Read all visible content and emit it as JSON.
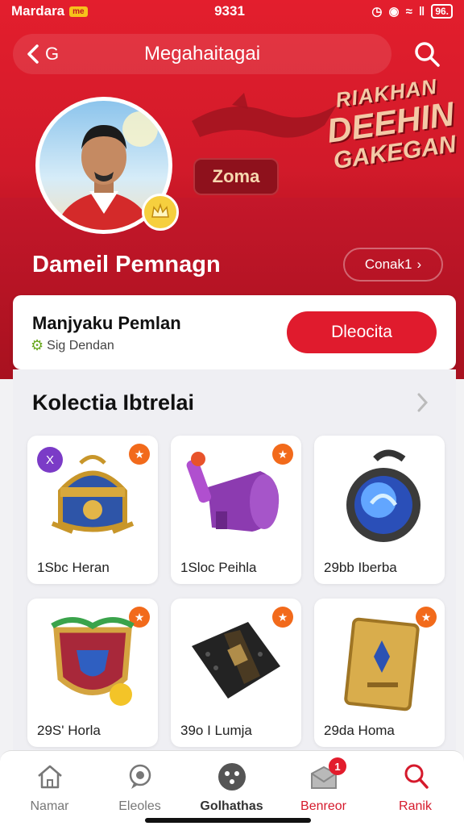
{
  "status_bar": {
    "carrier": "Mardara",
    "carrier_badge": "me",
    "time": "9331",
    "battery": "96."
  },
  "header": {
    "back_label": "G",
    "title": "Megahaitagai",
    "banner": {
      "line1": "RIAKHAN",
      "line2": "DEEHIN",
      "line3": "GAKEGAN"
    }
  },
  "profile": {
    "zone_label": "Zoma",
    "name": "Dameil Pemnagn",
    "contact_label": "Conak1"
  },
  "action_card": {
    "title": "Manjyaku Pemlan",
    "subtitle": "Sig Dendan",
    "button_label": "Dleocita"
  },
  "collection": {
    "title": "Kolectia Ibtrelai",
    "items": [
      {
        "label": "1Sbc Heran",
        "badge": "★",
        "tag": "X"
      },
      {
        "label": "1Sloc Peihla",
        "badge": "★"
      },
      {
        "label": "29bb Iberba",
        "badge": ""
      },
      {
        "label": "29S' Horla",
        "badge": "★"
      },
      {
        "label": "39o I Lumja",
        "badge": "★"
      },
      {
        "label": "29da Homa",
        "badge": "★"
      }
    ]
  },
  "bottom_nav": {
    "tabs": [
      {
        "label": "Namar",
        "icon": "home-icon"
      },
      {
        "label": "Eleoles",
        "icon": "chat-icon"
      },
      {
        "label": "Golhathas",
        "icon": "collection-icon"
      },
      {
        "label": "Benreor",
        "icon": "inbox-icon",
        "badge": "1"
      },
      {
        "label": "Ranik",
        "icon": "search-user-icon"
      }
    ]
  },
  "colors": {
    "primary": "#e01b2d",
    "hero_dark": "#8e0d18",
    "badge_orange": "#f26a1b",
    "tag_purple": "#7b3bc7"
  }
}
